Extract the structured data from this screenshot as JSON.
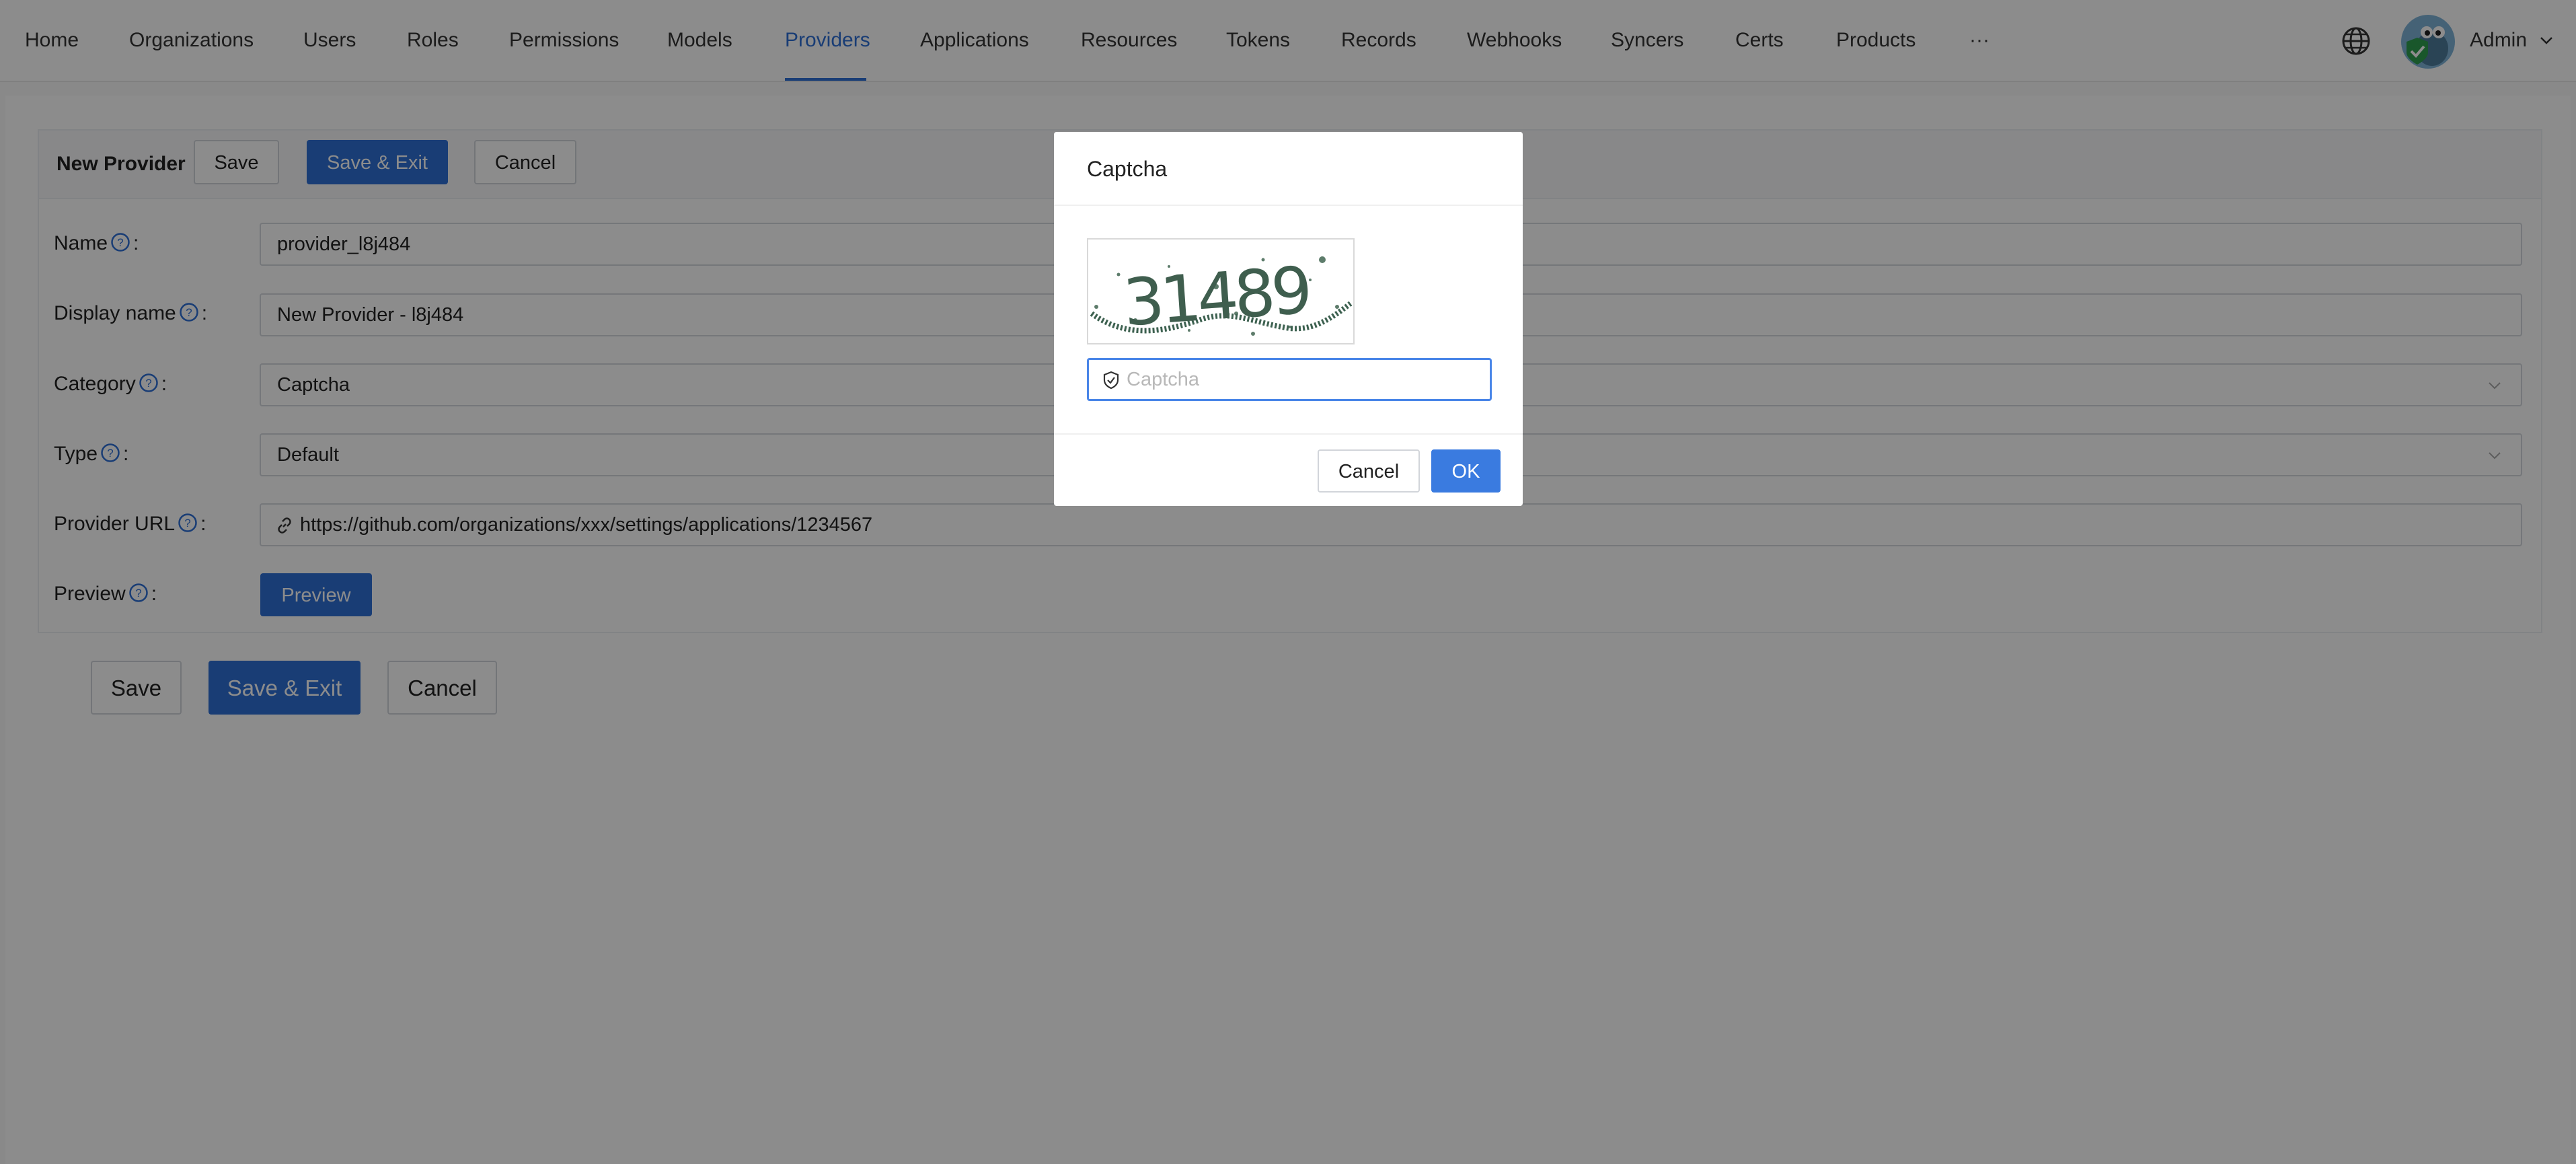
{
  "nav": {
    "items": [
      {
        "label": "Home"
      },
      {
        "label": "Organizations"
      },
      {
        "label": "Users"
      },
      {
        "label": "Roles"
      },
      {
        "label": "Permissions"
      },
      {
        "label": "Models"
      },
      {
        "label": "Providers",
        "active": true
      },
      {
        "label": "Applications"
      },
      {
        "label": "Resources"
      },
      {
        "label": "Tokens"
      },
      {
        "label": "Records"
      },
      {
        "label": "Webhooks"
      },
      {
        "label": "Syncers"
      },
      {
        "label": "Certs"
      },
      {
        "label": "Products"
      },
      {
        "label": "···"
      }
    ],
    "user_name": "Admin",
    "icons": {
      "language": "globe-icon",
      "user_menu": "chevron-down-icon"
    }
  },
  "card": {
    "title": "New Provider",
    "save_label": "Save",
    "save_exit_label": "Save & Exit",
    "cancel_label": "Cancel"
  },
  "form": {
    "name": {
      "label": "Name",
      "suffix": ":",
      "value": "provider_l8j484"
    },
    "display_name": {
      "label": "Display name",
      "suffix": ":",
      "value": "New Provider - l8j484"
    },
    "category": {
      "label": "Category",
      "suffix": ":",
      "value": "Captcha"
    },
    "type": {
      "label": "Type",
      "suffix": ":",
      "value": "Default"
    },
    "provider_url": {
      "label": "Provider URL",
      "suffix": ":",
      "value": "https://github.com/organizations/xxx/settings/applications/1234567"
    },
    "preview": {
      "label": "Preview",
      "suffix": ":",
      "button_label": "Preview"
    }
  },
  "footer": {
    "save_label": "Save",
    "save_exit_label": "Save & Exit",
    "cancel_label": "Cancel"
  },
  "modal": {
    "title": "Captcha",
    "captcha_text": "31489",
    "input_placeholder": "Captcha",
    "cancel_label": "Cancel",
    "ok_label": "OK"
  },
  "colors": {
    "accent": "#2f6fd6",
    "ok_button": "#3a7be0",
    "mask": "rgba(0,0,0,0.45)"
  }
}
